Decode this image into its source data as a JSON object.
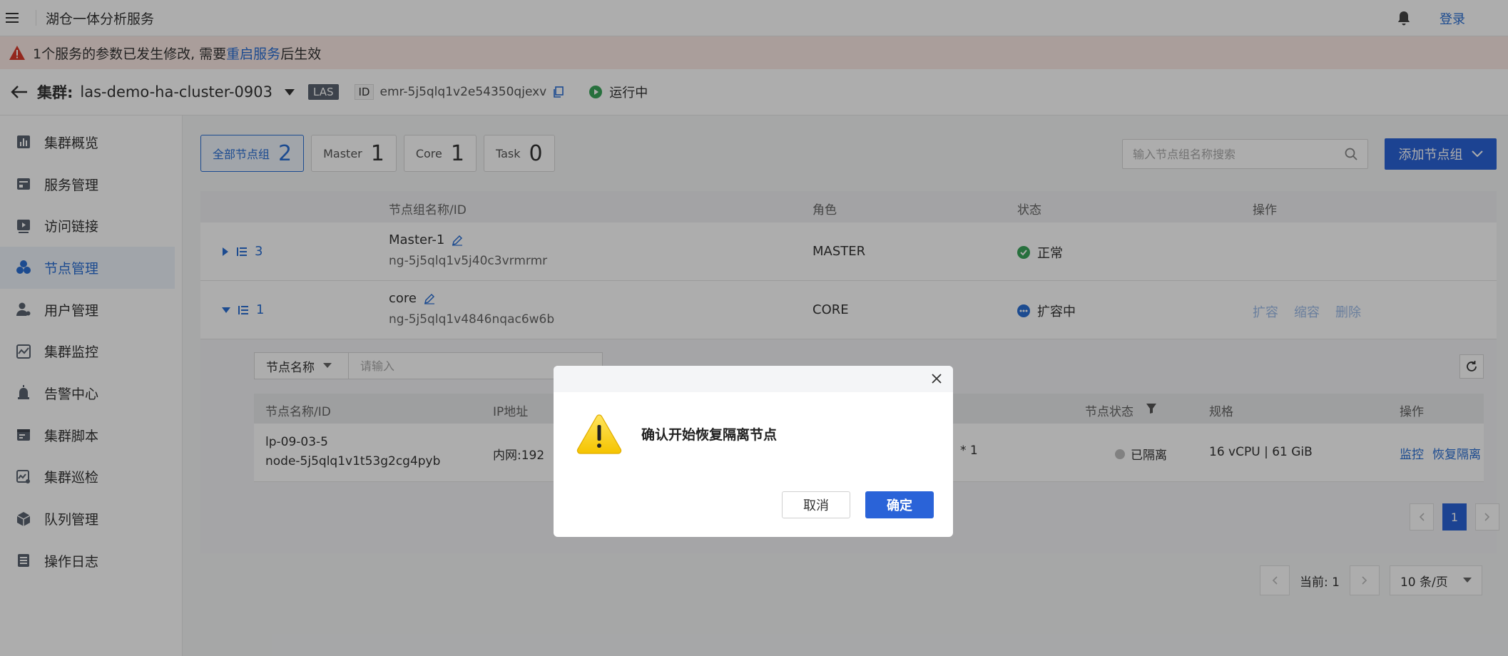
{
  "topbar": {
    "app_title": "湖仓一体分析服务",
    "login": "登录"
  },
  "alert": {
    "prefix": "1个服务的参数已发生修改, 需要",
    "link": "重启服务",
    "suffix": "后生效"
  },
  "cluster": {
    "prefix": "集群:",
    "name": "las-demo-ha-cluster-0903",
    "badge": "LAS",
    "id_label": "ID",
    "id_value": "emr-5j5qlq1v2e54350qjexv",
    "status": "运行中"
  },
  "sidebar": {
    "items": [
      {
        "label": "集群概览",
        "icon": "chart-icon"
      },
      {
        "label": "服务管理",
        "icon": "service-icon"
      },
      {
        "label": "访问链接",
        "icon": "link-icon"
      },
      {
        "label": "节点管理",
        "icon": "nodes-icon",
        "active": true
      },
      {
        "label": "用户管理",
        "icon": "user-icon"
      },
      {
        "label": "集群监控",
        "icon": "monitor-icon"
      },
      {
        "label": "告警中心",
        "icon": "alarm-icon"
      },
      {
        "label": "集群脚本",
        "icon": "script-icon"
      },
      {
        "label": "集群巡检",
        "icon": "inspect-icon"
      },
      {
        "label": "队列管理",
        "icon": "queue-icon"
      },
      {
        "label": "操作日志",
        "icon": "log-icon"
      }
    ]
  },
  "filters": {
    "tabs": [
      {
        "label": "全部节点组",
        "count": "2"
      },
      {
        "label": "Master",
        "count": "1"
      },
      {
        "label": "Core",
        "count": "1"
      },
      {
        "label": "Task",
        "count": "0"
      }
    ],
    "search_placeholder": "输入节点组名称搜索",
    "add_button": "添加节点组"
  },
  "table": {
    "headers": {
      "name": "节点组名称/ID",
      "role": "角色",
      "status": "状态",
      "ops": "操作"
    },
    "rows": [
      {
        "count": "3",
        "name": "Master-1",
        "id": "ng-5j5qlq1v5j40c3vrmrmr",
        "role": "MASTER",
        "status": "正常"
      },
      {
        "count": "1",
        "name": "core",
        "id": "ng-5j5qlq1v4846nqac6w6b",
        "role": "CORE",
        "status": "扩容中",
        "ops": [
          "扩容",
          "缩容",
          "删除"
        ]
      }
    ]
  },
  "subtable": {
    "filter_select": "节点名称",
    "filter_placeholder": "请输入",
    "headers": {
      "name": "节点名称/ID",
      "ip": "IP地址",
      "node_status": "节点状态",
      "spec": "规格",
      "ops": "操作"
    },
    "row": {
      "name": "lp-09-03-5",
      "id": "node-5j5qlq1v1t53g2cg4pyb",
      "ip": "内网:192",
      "mid": "* 1",
      "status": "已隔离",
      "spec": "16 vCPU | 61 GiB",
      "ops": [
        "监控",
        "恢复隔离"
      ]
    },
    "page": "1"
  },
  "pager": {
    "current": "当前: 1",
    "size": "10 条/页"
  },
  "dialog": {
    "message": "确认开始恢复隔离节点",
    "cancel": "取消",
    "confirm": "确定"
  },
  "colors": {
    "primary": "#2a63d8",
    "link": "#2a6fd4",
    "alert_bg": "#fbe9e5",
    "success": "#3aa55a",
    "overlay": "rgba(0,0,0,0.32)"
  }
}
